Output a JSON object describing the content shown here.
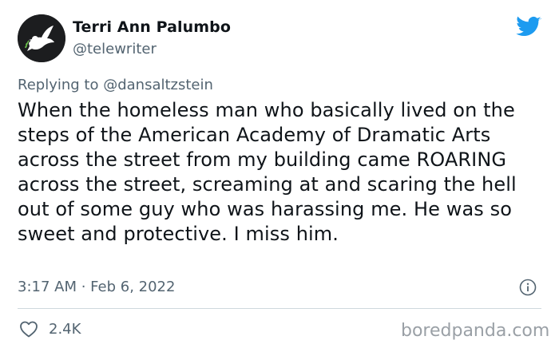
{
  "author": {
    "display_name": "Terri Ann Palumbo",
    "handle": "@telewriter",
    "avatar_icon": "dove-icon"
  },
  "brand": {
    "icon": "twitter-bird-icon",
    "color": "#1d9bf0"
  },
  "reply": {
    "prefix": "Replying to",
    "to": "@dansaltzstein",
    "text": "Replying to @dansaltzstein"
  },
  "tweet": {
    "text": "When the homeless man who basically lived on the steps of the American Academy of Dramatic Arts across the street from my building came ROARING across the street, screaming at and scaring the hell out of some guy who was harassing me. He was so sweet and protective. I miss him.",
    "timestamp": "3:17 AM · Feb 6, 2022"
  },
  "engagement": {
    "likes": "2.4K",
    "like_icon": "heart-icon",
    "info_icon": "info-icon"
  },
  "watermark": {
    "text": "boredpanda.com"
  },
  "colors": {
    "text_primary": "#0f1419",
    "text_secondary": "#536471",
    "divider": "#cfd9de"
  }
}
